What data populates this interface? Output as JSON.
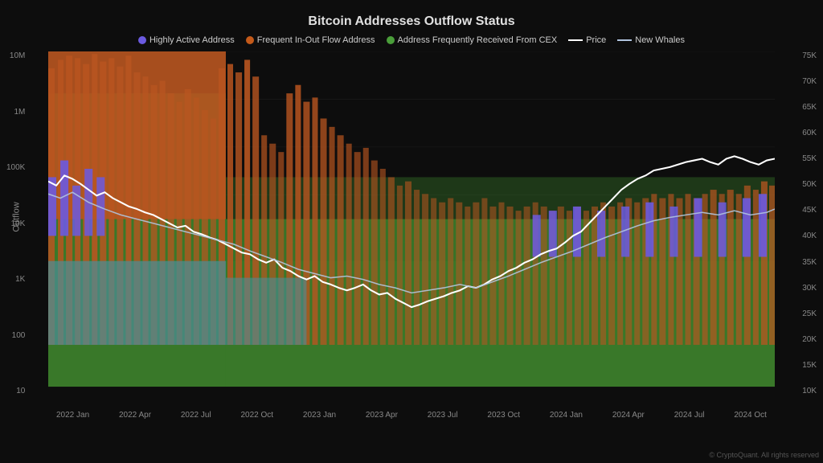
{
  "title": "Bitcoin Addresses Outflow Status",
  "legend": {
    "items": [
      {
        "label": "Highly Active Address",
        "type": "dot",
        "color": "#6B5AE0"
      },
      {
        "label": "Frequent In-Out Flow Address",
        "type": "dot",
        "color": "#C45A1A"
      },
      {
        "label": "Address Frequently Received From CEX",
        "type": "dot",
        "color": "#4A9E3A"
      },
      {
        "label": "Price",
        "type": "line",
        "color": "#FFFFFF"
      },
      {
        "label": "New Whales",
        "type": "line",
        "color": "#B0C4DE"
      }
    ]
  },
  "yAxisLeft": [
    "10M",
    "1M",
    "100K",
    "10K",
    "1K",
    "100",
    "10"
  ],
  "yAxisRight": [
    "75K",
    "70K",
    "65K",
    "60K",
    "55K",
    "50K",
    "45K",
    "40K",
    "35K",
    "30K",
    "25K",
    "20K",
    "15K",
    "10K"
  ],
  "xAxisLabels": [
    "2022 Jan",
    "2022 Apr",
    "2022 Jul",
    "2022 Oct",
    "2023 Jan",
    "2023 Apr",
    "2023 Jul",
    "2023 Oct",
    "2024 Jan",
    "2024 Apr",
    "2024 Jul",
    "2024 Oct"
  ],
  "yLabel": "Outflow",
  "copyright": "© CryptoQuant. All rights reserved"
}
